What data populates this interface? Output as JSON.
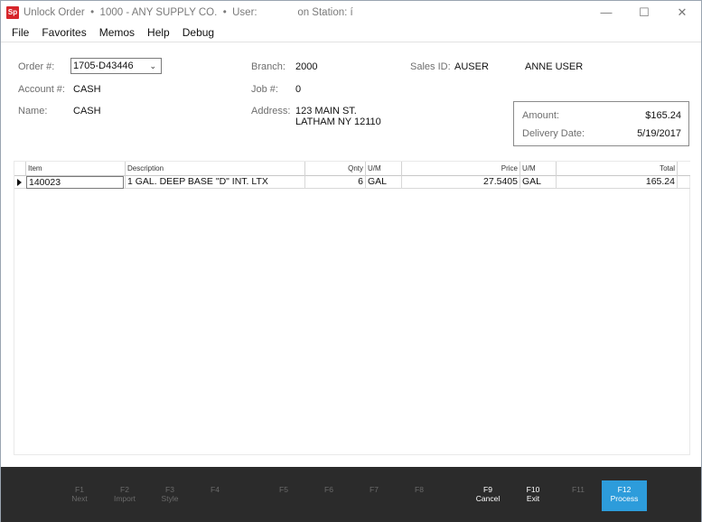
{
  "window": {
    "app_icon": "Sp",
    "title": "Unlock Order  •  1000 - ANY SUPPLY CO.  •  User:              on Station: í",
    "controls": {
      "minimize": "—",
      "maximize": "☐",
      "close": "✕"
    }
  },
  "menu": {
    "items": [
      "File",
      "Favorites",
      "Memos",
      "Help",
      "Debug"
    ]
  },
  "form": {
    "order_label": "Order #:",
    "order_value": "1705-D43446",
    "account_label": "Account #:",
    "account_value": "CASH",
    "name_label": "Name:",
    "name_value": "CASH",
    "branch_label": "Branch:",
    "branch_value": "2000",
    "job_label": "Job #:",
    "job_value": "0",
    "address_label": "Address:",
    "address_line1": "123 MAIN ST.",
    "address_line2": "LATHAM NY 12110",
    "sales_id_label": "Sales ID:",
    "sales_id_value": "AUSER",
    "sales_name": "ANNE USER"
  },
  "summary": {
    "amount_label": "Amount:",
    "amount_value": "$165.24",
    "delivery_label": "Delivery Date:",
    "delivery_value": "5/19/2017"
  },
  "grid": {
    "columns": [
      "Item",
      "Description",
      "Qnty",
      "U/M",
      "Price",
      "U/M",
      "Total"
    ],
    "rows": [
      {
        "item": "140023",
        "description": "1 GAL. DEEP BASE \"D\" INT. LTX",
        "qnty": "6",
        "um": "GAL",
        "price": "27.5405",
        "price_um": "GAL",
        "total": "165.24"
      }
    ]
  },
  "footer": {
    "keys": [
      {
        "key": "F1",
        "label": "Next"
      },
      {
        "key": "F2",
        "label": "Import"
      },
      {
        "key": "F3",
        "label": "Style"
      },
      {
        "key": "F4",
        "label": ""
      },
      {
        "key": "F5",
        "label": ""
      },
      {
        "key": "F6",
        "label": ""
      },
      {
        "key": "F7",
        "label": ""
      },
      {
        "key": "F8",
        "label": ""
      },
      {
        "key": "F9",
        "label": "Cancel"
      },
      {
        "key": "F10",
        "label": "Exit"
      },
      {
        "key": "F11",
        "label": ""
      },
      {
        "key": "F12",
        "label": "Process"
      }
    ],
    "colors": {
      "background": "#2b2b2b",
      "primary": "#2d9cdb"
    }
  }
}
